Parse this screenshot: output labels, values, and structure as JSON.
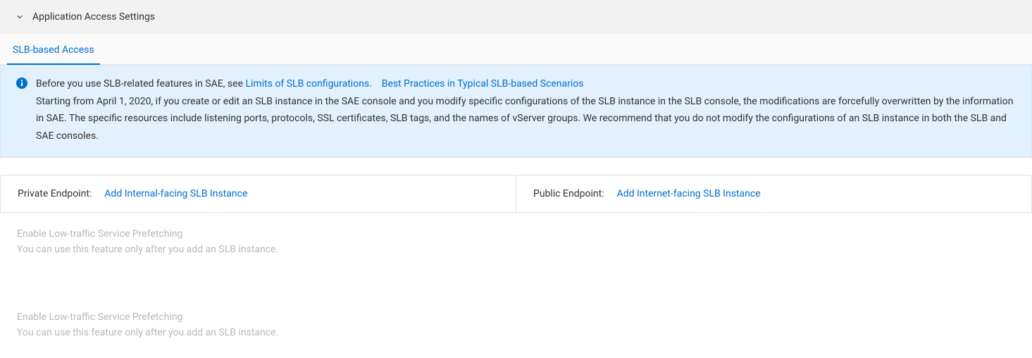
{
  "header": {
    "title": "Application Access Settings"
  },
  "tabs": {
    "slb": "SLB-based Access"
  },
  "banner": {
    "intro": "Before you use SLB-related features in SAE, see ",
    "link1": "Limits of SLB configurations.",
    "link2": "Best Practices in Typical SLB-based Scenarios",
    "body": "Starting from April 1, 2020, if you create or edit an SLB instance in the SAE console and you modify specific configurations of the SLB instance in the SLB console, the modifications are forcefully overwritten by the information in SAE. The specific resources include listening ports, protocols, SSL certificates, SLB tags, and the names of vServer groups. We recommend that you do not modify the configurations of an SLB instance in both the SLB and SAE consoles."
  },
  "endpoints": {
    "private_label": "Private Endpoint:",
    "private_action": "Add Internal-facing SLB Instance",
    "public_label": "Public Endpoint:",
    "public_action": "Add Internet-facing SLB Instance"
  },
  "prefetch": {
    "title": "Enable Low-traffic Service Prefetching",
    "hint": "You can use this feature only after you add an SLB instance."
  }
}
